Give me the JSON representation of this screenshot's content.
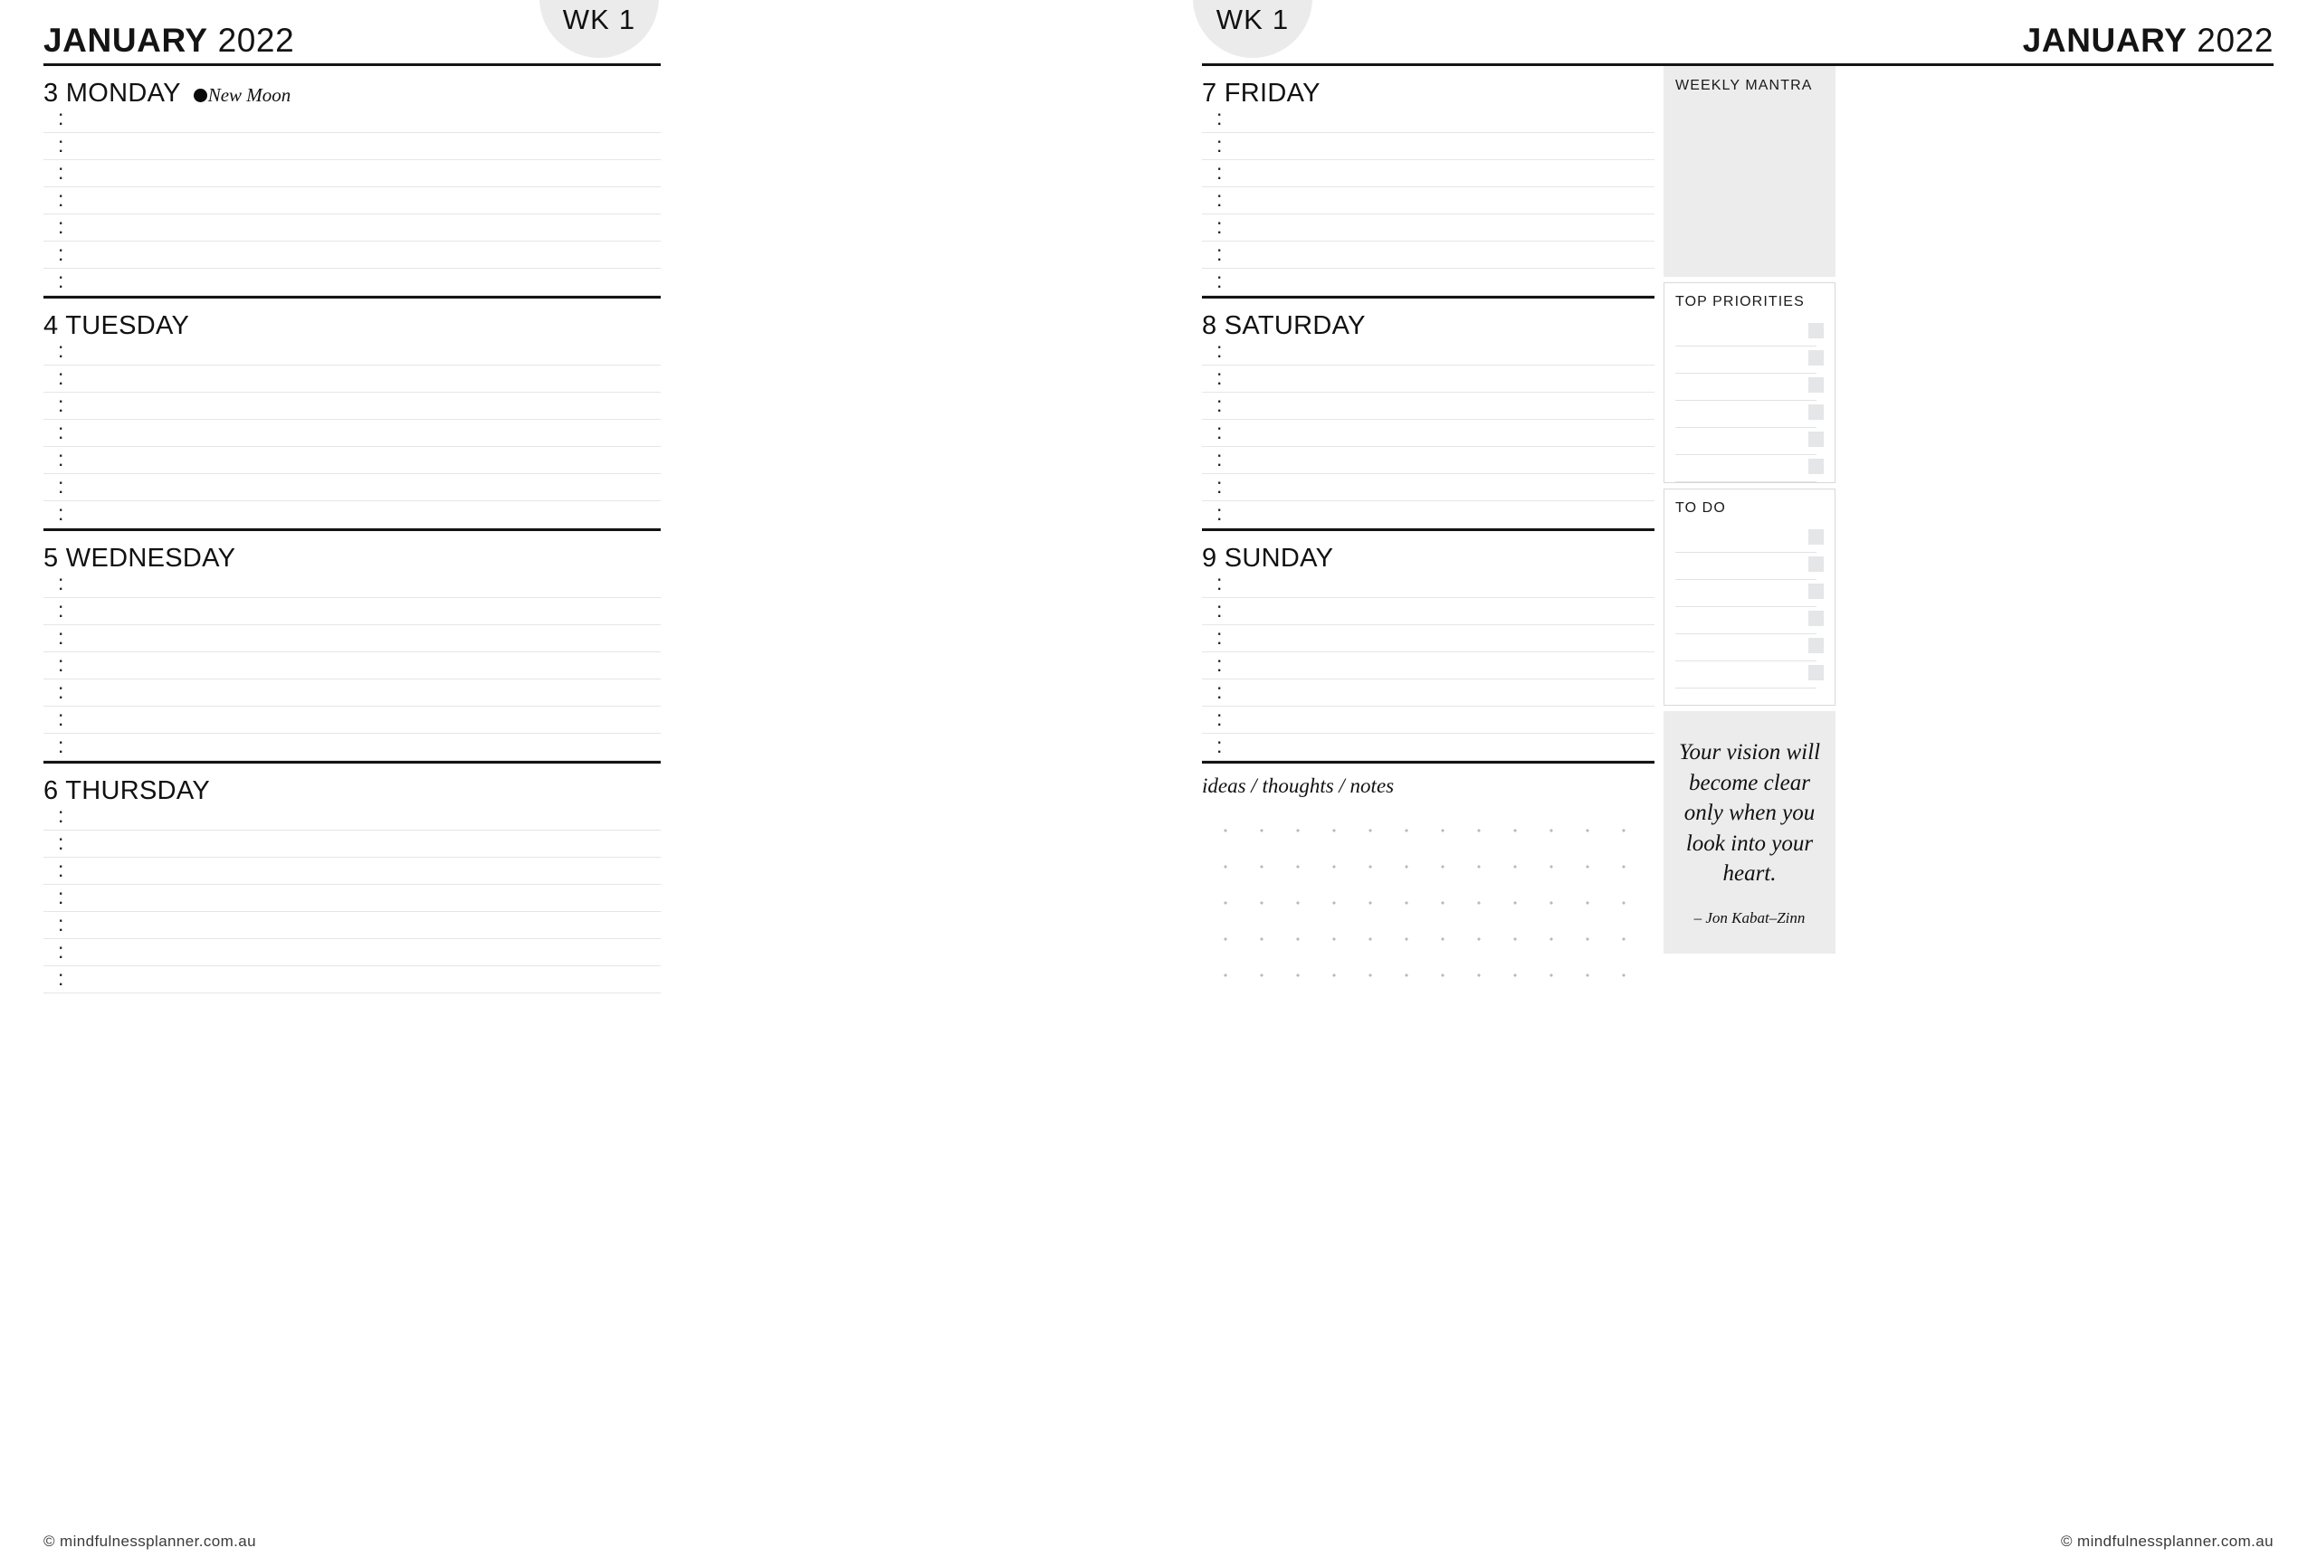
{
  "brand": {
    "footer": "© mindfulnessplanner.com.au",
    "accent_gray": "#ececec",
    "checkbox_gray": "#e4e6e8",
    "rule_light": "#e6e6e6",
    "rule_heavy": "#141414"
  },
  "left_page": {
    "week_badge": "WK 1",
    "month": "JANUARY",
    "year": "2022",
    "days": [
      {
        "label": "3 MONDAY",
        "marker": {
          "icon": "new-moon-icon",
          "text": "New Moon"
        },
        "slots": [
          ":",
          ":",
          ":",
          ":",
          ":",
          ":",
          ":"
        ]
      },
      {
        "label": "4 TUESDAY",
        "marker": null,
        "slots": [
          ":",
          ":",
          ":",
          ":",
          ":",
          ":",
          ":"
        ]
      },
      {
        "label": "5 WEDNESDAY",
        "marker": null,
        "slots": [
          ":",
          ":",
          ":",
          ":",
          ":",
          ":",
          ":"
        ]
      },
      {
        "label": "6 THURSDAY",
        "marker": null,
        "slots": [
          ":",
          ":",
          ":",
          ":",
          ":",
          ":",
          ":"
        ]
      }
    ]
  },
  "right_page": {
    "week_badge": "WK 1",
    "month": "JANUARY",
    "year": "2022",
    "days": [
      {
        "label": "7 FRIDAY",
        "slots": [
          ":",
          ":",
          ":",
          ":",
          ":",
          ":",
          ":"
        ]
      },
      {
        "label": "8 SATURDAY",
        "slots": [
          ":",
          ":",
          ":",
          ":",
          ":",
          ":",
          ":"
        ]
      },
      {
        "label": "9 SUNDAY",
        "slots": [
          ":",
          ":",
          ":",
          ":",
          ":",
          ":",
          ":"
        ]
      }
    ],
    "sidebar": {
      "weekly_mantra": {
        "title": "WEEKLY MANTRA",
        "value": ""
      },
      "top_priorities": {
        "title": "TOP PRIORITIES",
        "items": [
          "",
          "",
          "",
          "",
          "",
          ""
        ]
      },
      "to_do": {
        "title": "TO DO",
        "items": [
          "",
          "",
          "",
          "",
          "",
          ""
        ]
      },
      "quote": {
        "text": "Your vision will become clear only when you look into your heart.",
        "author": "– Jon Kabat–Zinn"
      }
    },
    "notes": {
      "label": "ideas / thoughts / notes",
      "grid": "dot-grid"
    }
  }
}
